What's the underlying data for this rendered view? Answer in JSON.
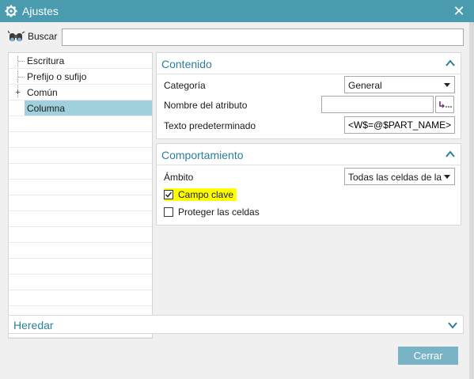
{
  "window": {
    "title": "Ajustes",
    "close_glyph": "✕"
  },
  "search": {
    "label": "Buscar",
    "value": ""
  },
  "tree": {
    "items": [
      {
        "label": "Escritura",
        "expandable": false,
        "selected": false
      },
      {
        "label": "Prefijo o sufijo",
        "expandable": false,
        "selected": false
      },
      {
        "label": "Común",
        "expandable": true,
        "selected": false
      },
      {
        "label": "Columna",
        "expandable": false,
        "selected": true
      }
    ],
    "expander_glyph": "+"
  },
  "contenido": {
    "header": "Contenido",
    "categoria_label": "Categoría",
    "categoria_value": "General",
    "nombre_label": "Nombre del atributo",
    "nombre_value": "",
    "texto_label": "Texto predeterminado",
    "texto_value": "<W$=@$PART_NAME>"
  },
  "comportamiento": {
    "header": "Comportamiento",
    "ambito_label": "Ámbito",
    "ambito_value": "Todas las celdas de la",
    "campo_clave_label": "Campo clave",
    "campo_clave_checked": true,
    "proteger_label": "Proteger las celdas",
    "proteger_checked": false
  },
  "heredar": {
    "header": "Heredar"
  },
  "footer": {
    "close_label": "Cerrar"
  },
  "colors": {
    "titlebar": "#4a9bb0",
    "accent_text": "#2b7f9a",
    "selection": "#9fd0dc",
    "highlight": "#ffff00",
    "button": "#78b4c6"
  }
}
